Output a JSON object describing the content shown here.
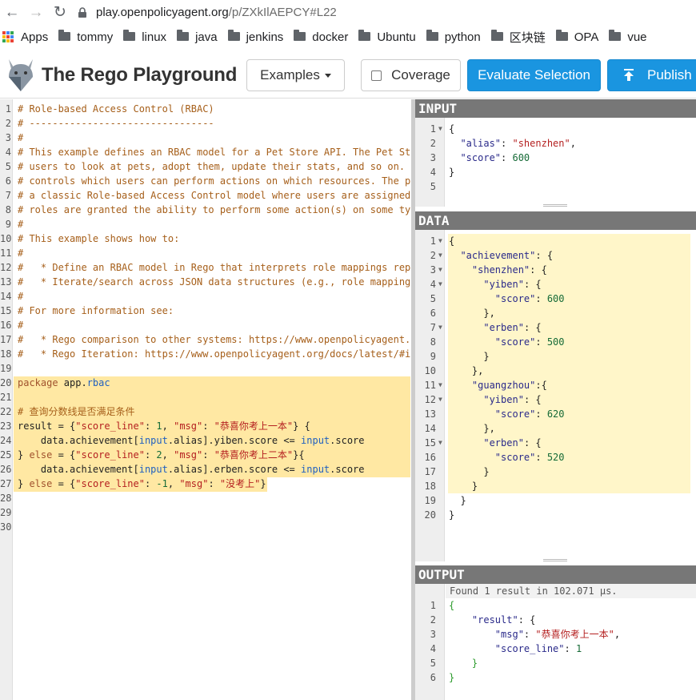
{
  "browser": {
    "url_host": "play.openpolicyagent.org",
    "url_path": "/p/ZXkIlAEPCY#L22",
    "bookmarks": [
      "Apps",
      "tommy",
      "linux",
      "java",
      "jenkins",
      "docker",
      "Ubuntu",
      "python",
      "区块链",
      "OPA",
      "vue"
    ]
  },
  "header": {
    "title": "The Rego Playground",
    "examples_label": "Examples",
    "coverage_label": "Coverage",
    "evaluate_label": "Evaluate Selection",
    "publish_label": "Publish"
  },
  "editor": {
    "lines": [
      {
        "n": "1",
        "t": "# Role-based Access Control (RBAC)"
      },
      {
        "n": "2",
        "t": "# --------------------------------"
      },
      {
        "n": "3",
        "t": "#"
      },
      {
        "n": "4",
        "t": "# This example defines an RBAC model for a Pet Store API. The Pet St"
      },
      {
        "n": "5",
        "t": "# users to look at pets, adopt them, update their stats, and so on."
      },
      {
        "n": "6",
        "t": "# controls which users can perform actions on which resources. The p"
      },
      {
        "n": "7",
        "t": "# a classic Role-based Access Control model where users are assigned"
      },
      {
        "n": "8",
        "t": "# roles are granted the ability to perform some action(s) on some ty"
      },
      {
        "n": "9",
        "t": "#"
      },
      {
        "n": "10",
        "t": "# This example shows how to:"
      },
      {
        "n": "11",
        "t": "#"
      },
      {
        "n": "12",
        "t": "#   * Define an RBAC model in Rego that interprets role mappings rep"
      },
      {
        "n": "13",
        "t": "#   * Iterate/search across JSON data structures (e.g., role mapping"
      },
      {
        "n": "14",
        "t": "#"
      },
      {
        "n": "15",
        "t": "# For more information see:"
      },
      {
        "n": "16",
        "t": "#"
      },
      {
        "n": "17",
        "t": "#   * Rego comparison to other systems: https://www.openpolicyagent."
      },
      {
        "n": "18",
        "t": "#   * Rego Iteration: https://www.openpolicyagent.org/docs/latest/#i"
      },
      {
        "n": "19",
        "t": ""
      },
      {
        "n": "20",
        "t": "package app.rbac"
      },
      {
        "n": "21",
        "t": ""
      },
      {
        "n": "22",
        "t": "# 查询分数线是否满足条件"
      },
      {
        "n": "23",
        "t": "result = {\"score_line\": 1, \"msg\": \"恭喜你考上一本\"} {"
      },
      {
        "n": "24",
        "t": "    data.achievement[input.alias].yiben.score <= input.score"
      },
      {
        "n": "25",
        "t": "} else = {\"score_line\": 2, \"msg\": \"恭喜你考上二本\"}{"
      },
      {
        "n": "26",
        "t": "    data.achievement[input.alias].erben.score <= input.score"
      },
      {
        "n": "27",
        "t": "} else = {\"score_line\": -1, \"msg\": \"没考上\"}"
      },
      {
        "n": "28",
        "t": ""
      },
      {
        "n": "29",
        "t": ""
      },
      {
        "n": "30",
        "t": ""
      }
    ]
  },
  "input_panel": {
    "title": "INPUT",
    "lines": [
      {
        "n": "1",
        "t": "{",
        "f": true
      },
      {
        "n": "2",
        "t": "  \"alias\": \"shenzhen\",",
        "f": false
      },
      {
        "n": "3",
        "t": "  \"score\": 600",
        "f": false
      },
      {
        "n": "4",
        "t": "}",
        "f": false
      },
      {
        "n": "5",
        "t": "",
        "f": false
      }
    ]
  },
  "data_panel": {
    "title": "DATA",
    "lines": [
      {
        "n": "1",
        "t": "{",
        "f": true
      },
      {
        "n": "2",
        "t": "  \"achievement\": {",
        "f": true
      },
      {
        "n": "3",
        "t": "    \"shenzhen\": {",
        "f": true
      },
      {
        "n": "4",
        "t": "      \"yiben\": {",
        "f": true
      },
      {
        "n": "5",
        "t": "        \"score\": 600",
        "f": false
      },
      {
        "n": "6",
        "t": "      },",
        "f": false
      },
      {
        "n": "7",
        "t": "      \"erben\": {",
        "f": true
      },
      {
        "n": "8",
        "t": "        \"score\": 500",
        "f": false
      },
      {
        "n": "9",
        "t": "      }",
        "f": false
      },
      {
        "n": "10",
        "t": "    },",
        "f": false
      },
      {
        "n": "11",
        "t": "    \"guangzhou\":{",
        "f": true
      },
      {
        "n": "12",
        "t": "      \"yiben\": {",
        "f": true
      },
      {
        "n": "13",
        "t": "        \"score\": 620",
        "f": false
      },
      {
        "n": "14",
        "t": "      },",
        "f": false
      },
      {
        "n": "15",
        "t": "      \"erben\": {",
        "f": true
      },
      {
        "n": "16",
        "t": "        \"score\": 520",
        "f": false
      },
      {
        "n": "17",
        "t": "      }",
        "f": false
      },
      {
        "n": "18",
        "t": "    }",
        "f": false
      },
      {
        "n": "19",
        "t": "  }",
        "f": false
      },
      {
        "n": "20",
        "t": "}",
        "f": false
      }
    ]
  },
  "output_panel": {
    "title": "OUTPUT",
    "status": "Found 1 result in 102.071 µs.",
    "lines": [
      {
        "n": "1",
        "t": "{"
      },
      {
        "n": "2",
        "t": "    \"result\": {"
      },
      {
        "n": "3",
        "t": "        \"msg\": \"恭喜你考上一本\","
      },
      {
        "n": "4",
        "t": "        \"score_line\": 1"
      },
      {
        "n": "5",
        "t": "    }"
      },
      {
        "n": "6",
        "t": "}"
      }
    ]
  },
  "colors": {
    "accent_blue": "#1a95e0",
    "panel_header": "#777777",
    "highlight": "#ffe8a3"
  }
}
